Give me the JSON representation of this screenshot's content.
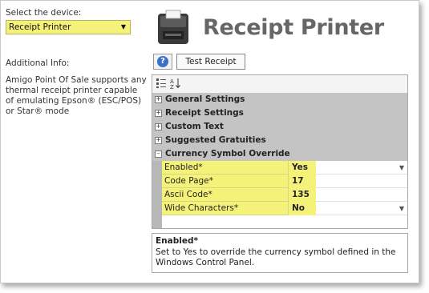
{
  "left": {
    "device_label": "Select the device:",
    "device_value": "Receipt Printer",
    "info_label": "Additional Info:",
    "info_text": "Amigo Point Of Sale supports any thermal receipt printer capable of emulating Epson® (ESC/POS) or Star® mode"
  },
  "header": {
    "title": "Receipt Printer",
    "help_label": "?",
    "test_button": "Test Receipt"
  },
  "grid": {
    "toolbar_icons": [
      "categorized-icon",
      "alphabetical-icon"
    ],
    "categories": [
      {
        "label": "General Settings",
        "expanded": false
      },
      {
        "label": "Receipt Settings",
        "expanded": false
      },
      {
        "label": "Custom Text",
        "expanded": false
      },
      {
        "label": "Suggested Gratuities",
        "expanded": false
      },
      {
        "label": "Currency Symbol Override",
        "expanded": true
      }
    ],
    "properties": [
      {
        "name": "Enabled*",
        "value": "Yes",
        "dropdown": true
      },
      {
        "name": "Code Page*",
        "value": "17",
        "dropdown": false
      },
      {
        "name": "Ascii Code*",
        "value": "135",
        "dropdown": false
      },
      {
        "name": "Wide Characters*",
        "value": "No",
        "dropdown": true
      }
    ]
  },
  "description": {
    "title": "Enabled*",
    "text": "Set to Yes to override the currency symbol defined in the Windows Control Panel."
  },
  "colors": {
    "highlight": "#f5f27a",
    "category_bg": "#c4c4c4",
    "title_gray": "#666666"
  }
}
